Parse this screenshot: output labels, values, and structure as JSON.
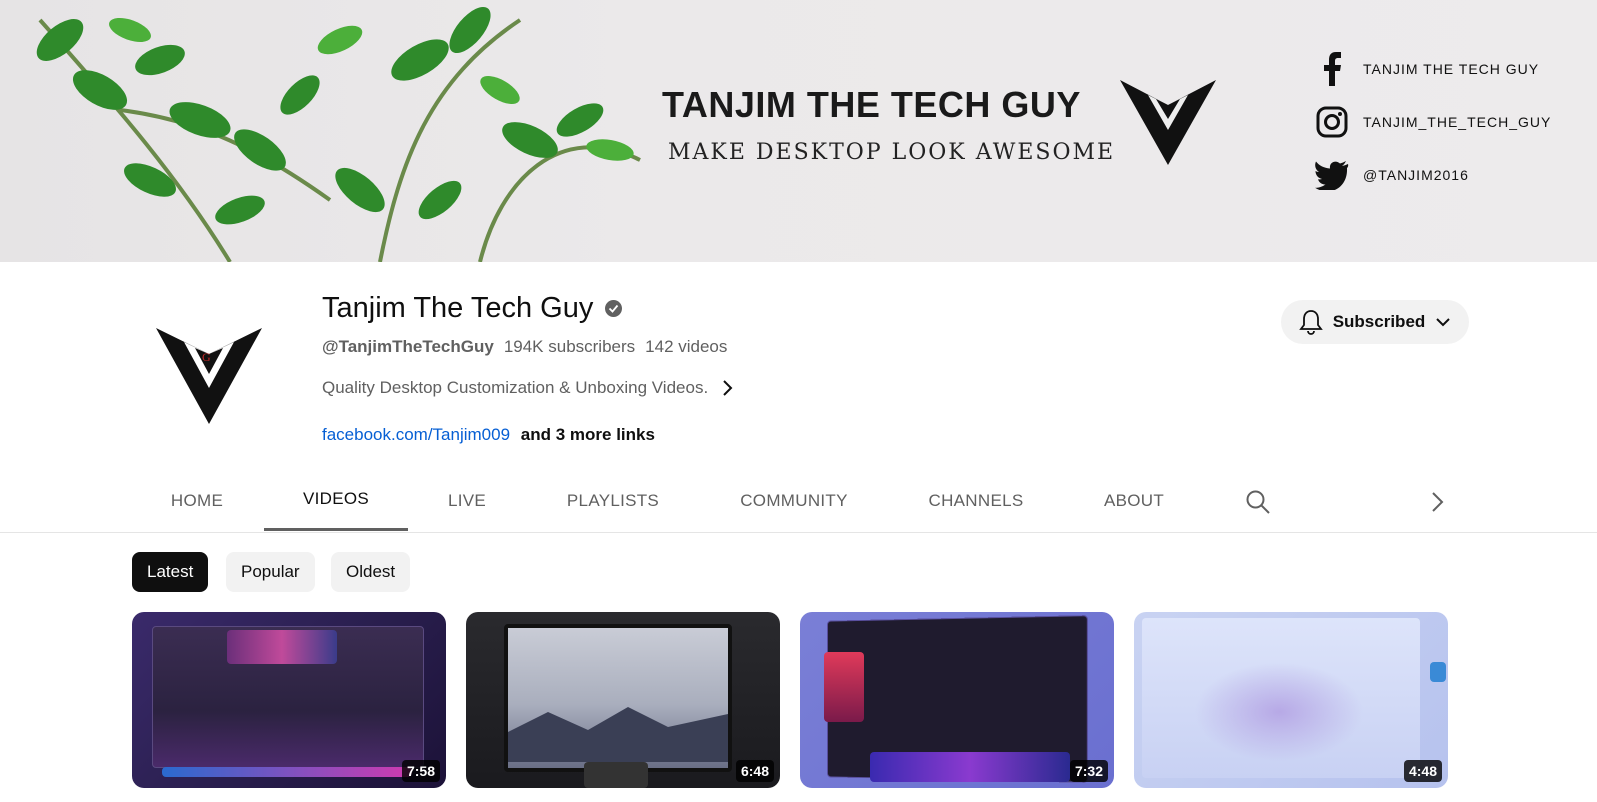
{
  "banner": {
    "title": "TANJIM THE TECH GUY",
    "subtitle": "MAKE DESKTOP LOOK AWESOME",
    "socials": [
      {
        "icon": "facebook-icon",
        "text": "TANJIM THE TECH GUY"
      },
      {
        "icon": "instagram-icon",
        "text": "TANJIM_THE_TECH_GUY"
      },
      {
        "icon": "twitter-icon",
        "text": "@TANJIM2016"
      }
    ]
  },
  "channel": {
    "name": "Tanjim The Tech Guy",
    "handle": "@TanjimTheTechGuy",
    "subscribers": "194K subscribers",
    "videos": "142 videos",
    "description": "Quality Desktop Customization & Unboxing Videos.",
    "link": "facebook.com/Tanjim009",
    "more_links": "and 3 more links"
  },
  "subscribe_button": {
    "label": "Subscribed"
  },
  "tabs": [
    {
      "label": "HOME"
    },
    {
      "label": "VIDEOS"
    },
    {
      "label": "LIVE"
    },
    {
      "label": "PLAYLISTS"
    },
    {
      "label": "COMMUNITY"
    },
    {
      "label": "CHANNELS"
    },
    {
      "label": "ABOUT"
    }
  ],
  "active_tab": "VIDEOS",
  "chips": [
    {
      "label": "Latest"
    },
    {
      "label": "Popular"
    },
    {
      "label": "Oldest"
    }
  ],
  "active_chip": "Latest",
  "videos": [
    {
      "duration": "7:58"
    },
    {
      "duration": "6:48"
    },
    {
      "duration": "7:32"
    },
    {
      "duration": "4:48"
    }
  ],
  "colors": {
    "link": "#065fd4",
    "text_primary": "#0f0f0f",
    "text_secondary": "#606060",
    "chip_bg": "#f2f2f2"
  }
}
